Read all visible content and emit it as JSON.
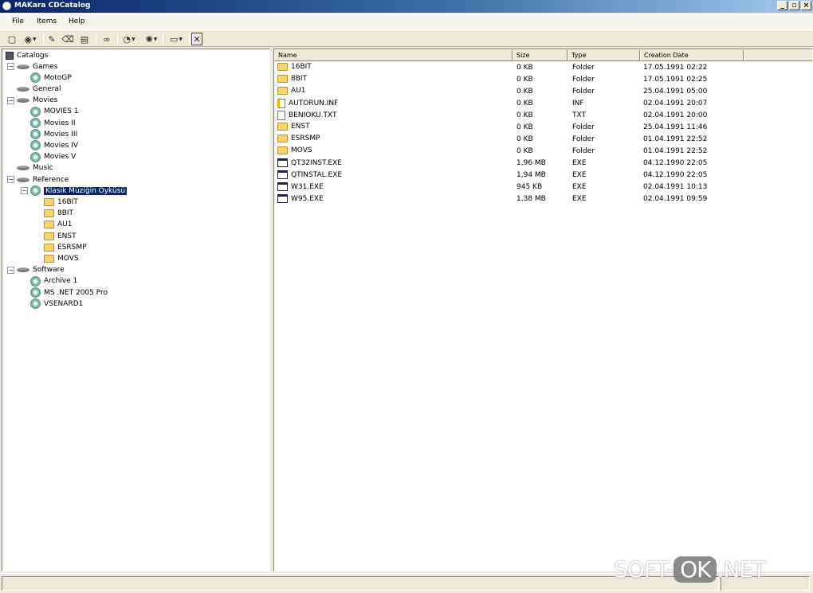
{
  "window": {
    "title": "MAKara CDCatalog"
  },
  "menu": [
    "File",
    "Items",
    "Help"
  ],
  "tree": {
    "root": "Catalogs",
    "nodes": [
      {
        "label": "Games",
        "type": "drive",
        "level": 1,
        "expander": "-"
      },
      {
        "label": "MotoGP",
        "type": "disc",
        "level": 2
      },
      {
        "label": "General",
        "type": "drive",
        "level": 1
      },
      {
        "label": "Movies",
        "type": "drive",
        "level": 1,
        "expander": "-"
      },
      {
        "label": "MOVIES 1",
        "type": "disc",
        "level": 2
      },
      {
        "label": "Movies II",
        "type": "disc",
        "level": 2
      },
      {
        "label": "Movies III",
        "type": "disc",
        "level": 2
      },
      {
        "label": "Movies IV",
        "type": "disc",
        "level": 2
      },
      {
        "label": "Movies V",
        "type": "disc",
        "level": 2
      },
      {
        "label": "Music",
        "type": "drive",
        "level": 1
      },
      {
        "label": "Reference",
        "type": "drive",
        "level": 1,
        "expander": "-"
      },
      {
        "label": "Klasik Müziğin Öyküsü",
        "type": "disc",
        "level": 2,
        "expander": "-",
        "selected": true
      },
      {
        "label": "16BIT",
        "type": "folder",
        "level": 3
      },
      {
        "label": "8BIT",
        "type": "folder",
        "level": 3
      },
      {
        "label": "AU1",
        "type": "folder",
        "level": 3
      },
      {
        "label": "ENST",
        "type": "folder",
        "level": 3
      },
      {
        "label": "ESRSMP",
        "type": "folder",
        "level": 3
      },
      {
        "label": "MOVS",
        "type": "folder",
        "level": 3
      },
      {
        "label": "Software",
        "type": "drive",
        "level": 1,
        "expander": "-"
      },
      {
        "label": "Archive 1",
        "type": "disc",
        "level": 2
      },
      {
        "label": "MS .NET 2005 Pro",
        "type": "disc",
        "level": 2
      },
      {
        "label": "VSENARD1",
        "type": "disc",
        "level": 2
      }
    ]
  },
  "list": {
    "columns": [
      "Name",
      "Size",
      "Type",
      "Creation Date"
    ],
    "rows": [
      {
        "name": "16BIT",
        "size": "0 KB",
        "type": "Folder",
        "date": "17.05.1991 02:22",
        "icon": "folder"
      },
      {
        "name": "8BIT",
        "size": "0 KB",
        "type": "Folder",
        "date": "17.05.1991 02:25",
        "icon": "folder"
      },
      {
        "name": "AU1",
        "size": "0 KB",
        "type": "Folder",
        "date": "25.04.1991 05:00",
        "icon": "folder"
      },
      {
        "name": "AUTORUN.INF",
        "size": "0 KB",
        "type": "INF",
        "date": "02.04.1991 20:07",
        "icon": "inf"
      },
      {
        "name": "BENIOKU.TXT",
        "size": "0 KB",
        "type": "TXT",
        "date": "02.04.1991 20:00",
        "icon": "file"
      },
      {
        "name": "ENST",
        "size": "0 KB",
        "type": "Folder",
        "date": "25.04.1991 11:46",
        "icon": "folder"
      },
      {
        "name": "ESRSMP",
        "size": "0 KB",
        "type": "Folder",
        "date": "01.04.1991 22:52",
        "icon": "folder"
      },
      {
        "name": "MOVS",
        "size": "0 KB",
        "type": "Folder",
        "date": "01.04.1991 22:52",
        "icon": "folder"
      },
      {
        "name": "QT32INST.EXE",
        "size": "1,96 MB",
        "type": "EXE",
        "date": "04.12.1990 22:05",
        "icon": "exe"
      },
      {
        "name": "QTINSTAL.EXE",
        "size": "1,94 MB",
        "type": "EXE",
        "date": "04.12.1990 22:05",
        "icon": "exe"
      },
      {
        "name": "W31.EXE",
        "size": "945 KB",
        "type": "EXE",
        "date": "02.04.1991 10:13",
        "icon": "exe"
      },
      {
        "name": "W95.EXE",
        "size": "1,38 MB",
        "type": "EXE",
        "date": "02.04.1991 09:59",
        "icon": "exe"
      }
    ]
  },
  "watermark": {
    "left": "SOFT-",
    "box": "OK",
    "right": ".NET"
  }
}
